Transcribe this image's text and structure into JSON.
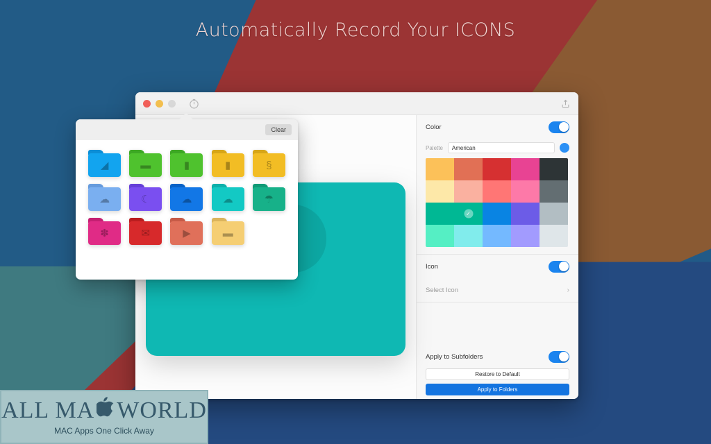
{
  "headline": "Automatically Record Your ICONS",
  "window": {
    "traffic_lights": [
      "close",
      "minimize",
      "zoom"
    ],
    "titlebar_icon": "timer-icon",
    "titlebar_right_icon": "export-icon"
  },
  "preview": {
    "folder_color": "#0fb8b3",
    "name": "folder-preview"
  },
  "settings": {
    "color": {
      "label": "Color",
      "enabled": true,
      "palette_label": "Palette",
      "palette_value": "American",
      "swatches": [
        {
          "hex": "#FCC159",
          "selected": false
        },
        {
          "hex": "#E17055",
          "selected": false
        },
        {
          "hex": "#D63031",
          "selected": false
        },
        {
          "hex": "#E84393",
          "selected": false
        },
        {
          "hex": "#2D3436",
          "selected": false
        },
        {
          "hex": "#FDE8A8",
          "selected": false
        },
        {
          "hex": "#FAB1A0",
          "selected": false
        },
        {
          "hex": "#FF7675",
          "selected": false
        },
        {
          "hex": "#FD79A8",
          "selected": false
        },
        {
          "hex": "#636E72",
          "selected": false
        },
        {
          "hex": "#00B894",
          "selected": false
        },
        {
          "hex": "#00B894",
          "selected": true
        },
        {
          "hex": "#0984E3",
          "selected": false
        },
        {
          "hex": "#6C5CE7",
          "selected": false
        },
        {
          "hex": "#B2BEC3",
          "selected": false
        },
        {
          "hex": "#55EFC4",
          "selected": false
        },
        {
          "hex": "#81ECEC",
          "selected": false
        },
        {
          "hex": "#74B9FF",
          "selected": false
        },
        {
          "hex": "#A29BFE",
          "selected": false
        },
        {
          "hex": "#DFE6E9",
          "selected": false
        }
      ]
    },
    "icon": {
      "label": "Icon",
      "enabled": true,
      "select_label": "Select Icon"
    },
    "apply": {
      "subfolders_label": "Apply to Subfolders",
      "subfolders_enabled": true,
      "restore_label": "Restore to Default",
      "apply_label": "Apply to Folders"
    }
  },
  "popover": {
    "clear_label": "Clear",
    "folders": [
      {
        "color": "#12a4ef",
        "tab": "#0c8ed6",
        "glyph": "bag-icon",
        "char": "◢"
      },
      {
        "color": "#4fc22e",
        "tab": "#3da824",
        "glyph": "battery-icon",
        "char": "▬"
      },
      {
        "color": "#4fc22e",
        "tab": "#3da824",
        "glyph": "capsule-icon",
        "char": "▮"
      },
      {
        "color": "#f2bd24",
        "tab": "#d7a618",
        "glyph": "capsule-icon",
        "char": "▮"
      },
      {
        "color": "#f2bd24",
        "tab": "#d7a618",
        "glyph": "section-icon",
        "char": "§"
      },
      {
        "color": "#7aaff0",
        "tab": "#669bdd",
        "glyph": "cloud-icon",
        "char": "☁"
      },
      {
        "color": "#7a4ff0",
        "tab": "#6640d8",
        "glyph": "moon-icon",
        "char": "☾"
      },
      {
        "color": "#1277e6",
        "tab": "#0a63c7",
        "glyph": "cloud-moon-icon",
        "char": "☁"
      },
      {
        "color": "#13c9c4",
        "tab": "#0eb0ab",
        "glyph": "cloud-fog-icon",
        "char": "☁"
      },
      {
        "color": "#17b189",
        "tab": "#119a76",
        "glyph": "umbrella-icon",
        "char": "☂"
      },
      {
        "color": "#e02b86",
        "tab": "#c41f72",
        "glyph": "atom-icon",
        "char": "✽"
      },
      {
        "color": "#d7292b",
        "tab": "#ba1d1f",
        "glyph": "mail-icon",
        "char": "✉"
      },
      {
        "color": "#e0705a",
        "tab": "#c65b47",
        "glyph": "video-icon",
        "char": "▶"
      },
      {
        "color": "#f5ce73",
        "tab": "#dbb45c",
        "glyph": "comment-icon",
        "char": "▬"
      }
    ]
  },
  "watermark": {
    "line1_a": "ALL MA",
    "line1_b": "WORLD",
    "apple": "",
    "tagline": "MAC Apps One Click Away"
  }
}
